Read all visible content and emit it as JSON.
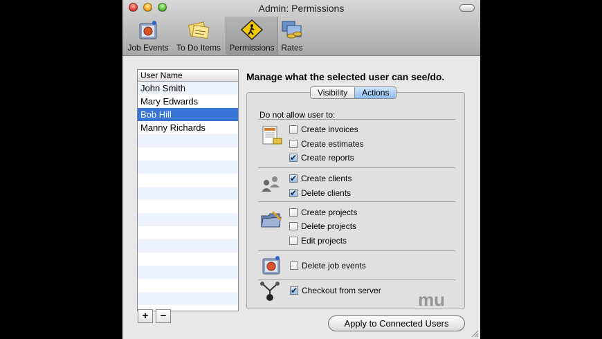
{
  "window": {
    "title": "Admin: Permissions"
  },
  "toolbar": {
    "items": [
      {
        "label": "Job Events",
        "icon": "job-events-icon"
      },
      {
        "label": "To Do Items",
        "icon": "todo-notes-icon"
      },
      {
        "label": "Permissions",
        "icon": "permissions-sign-icon",
        "selected": true
      },
      {
        "label": "Rates",
        "icon": "rates-icon"
      }
    ]
  },
  "user_list": {
    "header": "User Name",
    "users": [
      {
        "name": "John Smith",
        "selected": false
      },
      {
        "name": "Mary Edwards",
        "selected": false
      },
      {
        "name": "Bob Hill",
        "selected": true
      },
      {
        "name": "Manny Richards",
        "selected": false
      }
    ],
    "add_label": "+",
    "remove_label": "−"
  },
  "permissions": {
    "heading": "Manage what the selected user can see/do.",
    "tabs": [
      {
        "label": "Visibility",
        "active": false
      },
      {
        "label": "Actions",
        "active": true
      }
    ],
    "intro": "Do not allow user to:",
    "groups": [
      {
        "icon": "invoice-icon",
        "items": [
          {
            "label": "Create invoices",
            "checked": false
          },
          {
            "label": "Create estimates",
            "checked": false
          },
          {
            "label": "Create reports",
            "checked": true
          }
        ]
      },
      {
        "icon": "clients-icon",
        "items": [
          {
            "label": "Create clients",
            "checked": true
          },
          {
            "label": "Delete clients",
            "checked": true
          }
        ]
      },
      {
        "icon": "projects-folder-icon",
        "items": [
          {
            "label": "Create projects",
            "checked": false
          },
          {
            "label": "Delete projects",
            "checked": false
          },
          {
            "label": "Edit projects",
            "checked": false
          }
        ]
      },
      {
        "icon": "job-events-icon",
        "items": [
          {
            "label": "Delete job events",
            "checked": false
          }
        ]
      },
      {
        "icon": "checkout-server-icon",
        "items": [
          {
            "label": "Checkout from server",
            "checked": true
          }
        ]
      }
    ]
  },
  "apply_button": {
    "label": "Apply to Connected Users"
  },
  "watermark": "mu"
}
